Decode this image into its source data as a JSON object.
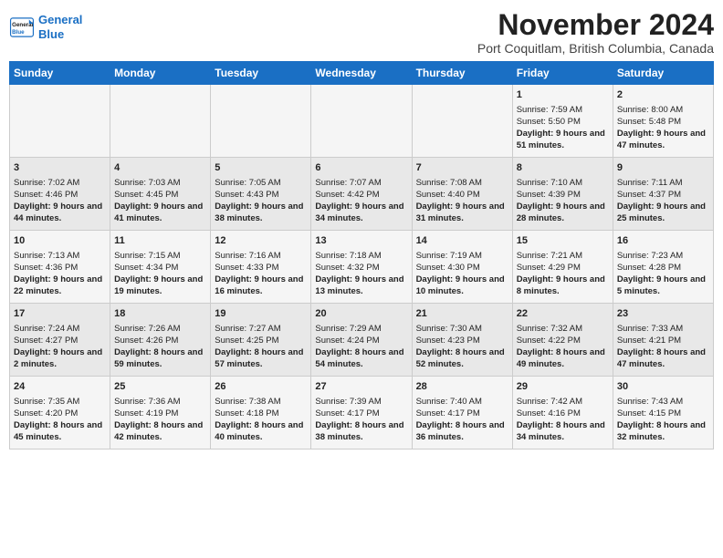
{
  "header": {
    "logo_line1": "General",
    "logo_line2": "Blue",
    "month_title": "November 2024",
    "subtitle": "Port Coquitlam, British Columbia, Canada"
  },
  "weekdays": [
    "Sunday",
    "Monday",
    "Tuesday",
    "Wednesday",
    "Thursday",
    "Friday",
    "Saturday"
  ],
  "weeks": [
    [
      {
        "day": "",
        "info": ""
      },
      {
        "day": "",
        "info": ""
      },
      {
        "day": "",
        "info": ""
      },
      {
        "day": "",
        "info": ""
      },
      {
        "day": "",
        "info": ""
      },
      {
        "day": "1",
        "info": "Sunrise: 7:59 AM\nSunset: 5:50 PM\nDaylight: 9 hours and 51 minutes."
      },
      {
        "day": "2",
        "info": "Sunrise: 8:00 AM\nSunset: 5:48 PM\nDaylight: 9 hours and 47 minutes."
      }
    ],
    [
      {
        "day": "3",
        "info": "Sunrise: 7:02 AM\nSunset: 4:46 PM\nDaylight: 9 hours and 44 minutes."
      },
      {
        "day": "4",
        "info": "Sunrise: 7:03 AM\nSunset: 4:45 PM\nDaylight: 9 hours and 41 minutes."
      },
      {
        "day": "5",
        "info": "Sunrise: 7:05 AM\nSunset: 4:43 PM\nDaylight: 9 hours and 38 minutes."
      },
      {
        "day": "6",
        "info": "Sunrise: 7:07 AM\nSunset: 4:42 PM\nDaylight: 9 hours and 34 minutes."
      },
      {
        "day": "7",
        "info": "Sunrise: 7:08 AM\nSunset: 4:40 PM\nDaylight: 9 hours and 31 minutes."
      },
      {
        "day": "8",
        "info": "Sunrise: 7:10 AM\nSunset: 4:39 PM\nDaylight: 9 hours and 28 minutes."
      },
      {
        "day": "9",
        "info": "Sunrise: 7:11 AM\nSunset: 4:37 PM\nDaylight: 9 hours and 25 minutes."
      }
    ],
    [
      {
        "day": "10",
        "info": "Sunrise: 7:13 AM\nSunset: 4:36 PM\nDaylight: 9 hours and 22 minutes."
      },
      {
        "day": "11",
        "info": "Sunrise: 7:15 AM\nSunset: 4:34 PM\nDaylight: 9 hours and 19 minutes."
      },
      {
        "day": "12",
        "info": "Sunrise: 7:16 AM\nSunset: 4:33 PM\nDaylight: 9 hours and 16 minutes."
      },
      {
        "day": "13",
        "info": "Sunrise: 7:18 AM\nSunset: 4:32 PM\nDaylight: 9 hours and 13 minutes."
      },
      {
        "day": "14",
        "info": "Sunrise: 7:19 AM\nSunset: 4:30 PM\nDaylight: 9 hours and 10 minutes."
      },
      {
        "day": "15",
        "info": "Sunrise: 7:21 AM\nSunset: 4:29 PM\nDaylight: 9 hours and 8 minutes."
      },
      {
        "day": "16",
        "info": "Sunrise: 7:23 AM\nSunset: 4:28 PM\nDaylight: 9 hours and 5 minutes."
      }
    ],
    [
      {
        "day": "17",
        "info": "Sunrise: 7:24 AM\nSunset: 4:27 PM\nDaylight: 9 hours and 2 minutes."
      },
      {
        "day": "18",
        "info": "Sunrise: 7:26 AM\nSunset: 4:26 PM\nDaylight: 8 hours and 59 minutes."
      },
      {
        "day": "19",
        "info": "Sunrise: 7:27 AM\nSunset: 4:25 PM\nDaylight: 8 hours and 57 minutes."
      },
      {
        "day": "20",
        "info": "Sunrise: 7:29 AM\nSunset: 4:24 PM\nDaylight: 8 hours and 54 minutes."
      },
      {
        "day": "21",
        "info": "Sunrise: 7:30 AM\nSunset: 4:23 PM\nDaylight: 8 hours and 52 minutes."
      },
      {
        "day": "22",
        "info": "Sunrise: 7:32 AM\nSunset: 4:22 PM\nDaylight: 8 hours and 49 minutes."
      },
      {
        "day": "23",
        "info": "Sunrise: 7:33 AM\nSunset: 4:21 PM\nDaylight: 8 hours and 47 minutes."
      }
    ],
    [
      {
        "day": "24",
        "info": "Sunrise: 7:35 AM\nSunset: 4:20 PM\nDaylight: 8 hours and 45 minutes."
      },
      {
        "day": "25",
        "info": "Sunrise: 7:36 AM\nSunset: 4:19 PM\nDaylight: 8 hours and 42 minutes."
      },
      {
        "day": "26",
        "info": "Sunrise: 7:38 AM\nSunset: 4:18 PM\nDaylight: 8 hours and 40 minutes."
      },
      {
        "day": "27",
        "info": "Sunrise: 7:39 AM\nSunset: 4:17 PM\nDaylight: 8 hours and 38 minutes."
      },
      {
        "day": "28",
        "info": "Sunrise: 7:40 AM\nSunset: 4:17 PM\nDaylight: 8 hours and 36 minutes."
      },
      {
        "day": "29",
        "info": "Sunrise: 7:42 AM\nSunset: 4:16 PM\nDaylight: 8 hours and 34 minutes."
      },
      {
        "day": "30",
        "info": "Sunrise: 7:43 AM\nSunset: 4:15 PM\nDaylight: 8 hours and 32 minutes."
      }
    ]
  ]
}
